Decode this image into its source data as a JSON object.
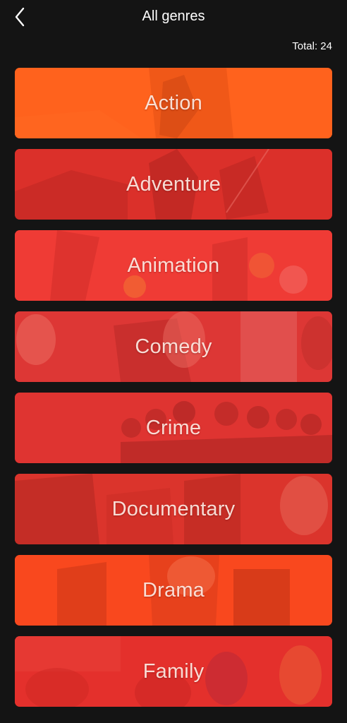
{
  "header": {
    "title": "All genres",
    "back_icon": "chevron-left-icon",
    "total_label": "Total: 24"
  },
  "colors": {
    "background": "#141414",
    "overlay_orange": "#ff5a1a",
    "overlay_red": "#e0312b"
  },
  "genres": [
    {
      "label": "Action",
      "overlay": "#ff5b1c"
    },
    {
      "label": "Adventure",
      "overlay": "#de2f29"
    },
    {
      "label": "Animation",
      "overlay": "#ef3a34"
    },
    {
      "label": "Comedy",
      "overlay": "#e53a37"
    },
    {
      "label": "Crime",
      "overlay": "#e23633"
    },
    {
      "label": "Documentary",
      "overlay": "#e0352d"
    },
    {
      "label": "Drama",
      "overlay": "#ff4a1c"
    },
    {
      "label": "Family",
      "overlay": "#e8312d"
    }
  ]
}
